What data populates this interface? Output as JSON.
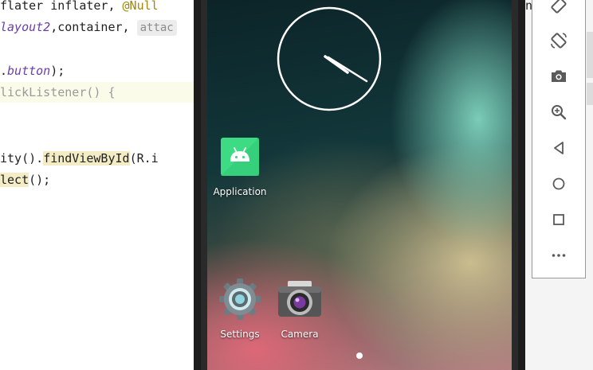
{
  "editor": {
    "lines": {
      "l1": {
        "p1": "flater inflater, ",
        "annot": "@Null"
      },
      "l2": {
        "p1": "layout2",
        "p2": ",container, ",
        "hint": "attac"
      },
      "l3": {
        "p1": ".",
        "p2": "button",
        "p3": ");"
      },
      "l4": {
        "p1": "lickListener() {"
      },
      "l5": {
        "p1": "ity().",
        "p2": "findViewById",
        "p3": "(R.i"
      },
      "l6": {
        "p1": "lect",
        "p2": "();"
      }
    },
    "right_edge_fragment": "n"
  },
  "phone": {
    "apps": {
      "application": {
        "label": "Application",
        "icon": "android-robot-icon"
      },
      "settings": {
        "label": "Settings",
        "icon": "gear-icon"
      },
      "camera": {
        "label": "Camera",
        "icon": "camera-app-icon"
      }
    }
  },
  "toolbar": {
    "buttons": [
      "rotate-left-icon",
      "rotate-right-icon",
      "screenshot-camera-icon",
      "zoom-icon",
      "back-icon",
      "home-icon",
      "overview-icon",
      "more-icon"
    ]
  },
  "colors": {
    "android_green": "#3ddc84",
    "toolbar_icon": "#5a5a5a"
  }
}
